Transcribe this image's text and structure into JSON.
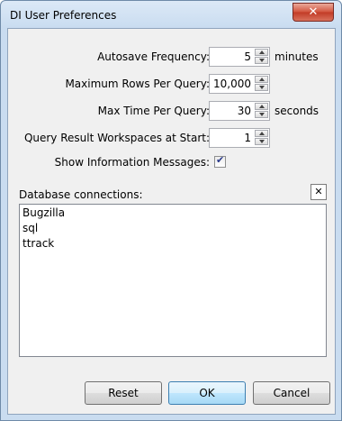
{
  "window": {
    "title": "DI User Preferences",
    "close_label": "✕"
  },
  "settings": {
    "autosave": {
      "label": "Autosave Frequency:",
      "value": "5",
      "unit": "minutes"
    },
    "max_rows": {
      "label": "Maximum Rows Per Query:",
      "value": "10,000",
      "unit": ""
    },
    "max_time": {
      "label": "Max Time Per Query:",
      "value": "30",
      "unit": "seconds"
    },
    "workspaces": {
      "label": "Query Result Workspaces at Start:",
      "value": "1",
      "unit": ""
    },
    "show_info": {
      "label": "Show Information Messages:",
      "checked": true,
      "mark": "✔"
    }
  },
  "database": {
    "label": "Database connections:",
    "remove_label": "✕",
    "items": [
      "Bugzilla",
      "sql",
      "ttrack"
    ]
  },
  "buttons": {
    "reset": "Reset",
    "ok": "OK",
    "cancel": "Cancel"
  }
}
